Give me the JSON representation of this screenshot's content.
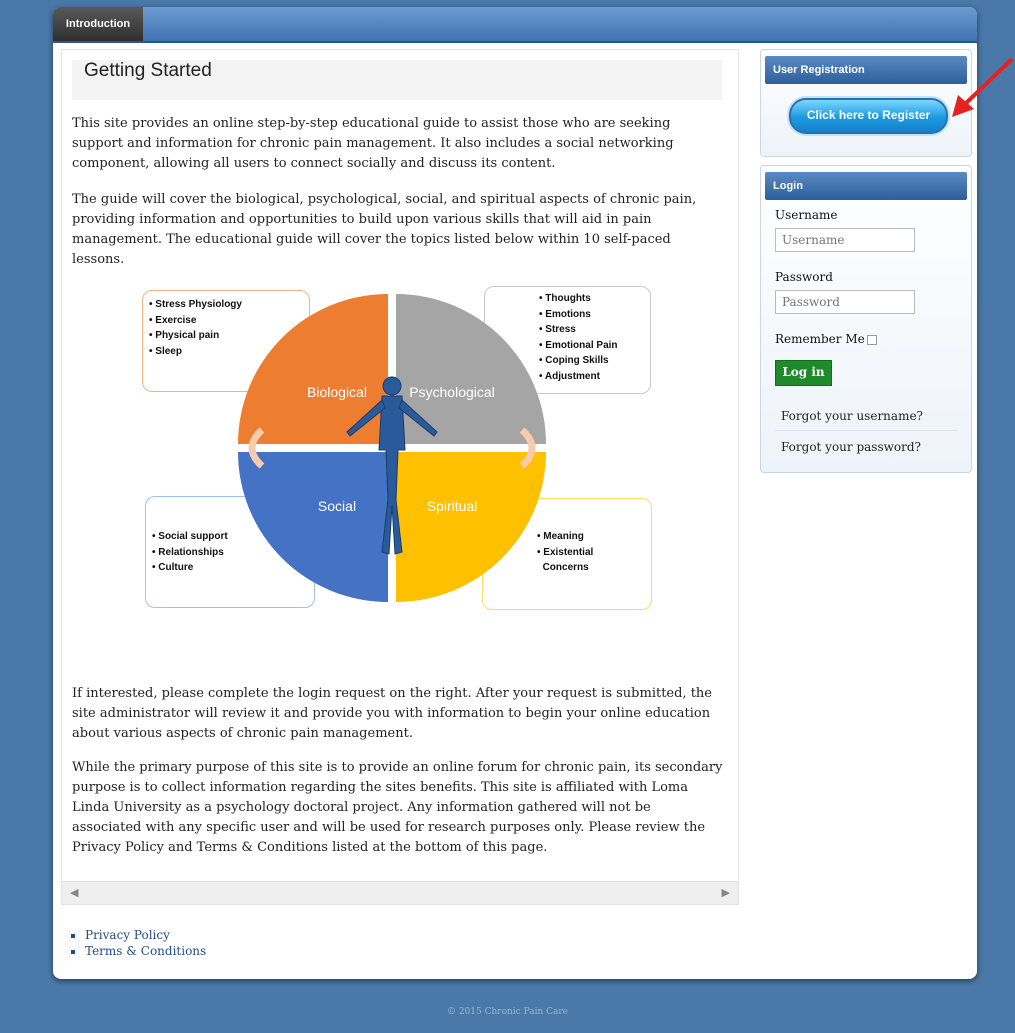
{
  "nav": {
    "tab_intro": "Introduction"
  },
  "main": {
    "title": "Getting Started",
    "para1": "This site provides an online step-by-step educational guide to assist those who are seeking support and information for chronic pain management. It also includes a social networking component, allowing all users to connect socially and discuss its content.",
    "para2": "The guide will cover the biological, psychological, social, and spiritual aspects of chronic pain, providing information and opportunities to build upon various skills that will aid in pain management. The educational guide will cover the topics listed below within 10 self-paced lessons.",
    "para3": "If interested, please complete the login request on the right. After your request is submitted, the site administrator will review it and provide you with information to begin your online education about various aspects of chronic pain management.",
    "para4": "While the primary purpose of this site is to provide an online forum for chronic pain, its secondary purpose is to collect information regarding the sites benefits. This site is affiliated with Loma Linda University as a psychology doctoral project. Any information gathered will not be associated with any specific user and will be used for research purposes only. Please review the Privacy Policy and Terms & Conditions listed at the bottom of this page."
  },
  "diagram": {
    "biological": {
      "label": "Biological",
      "color": "#ed7d31",
      "items": [
        "Stress Physiology",
        "Exercise",
        "Physical pain",
        "Sleep"
      ]
    },
    "psychological": {
      "label": "Psychological",
      "color": "#a5a5a5",
      "items": [
        "Thoughts",
        "Emotions",
        "Stress",
        "Emotional Pain",
        "Coping Skills",
        "Adjustment"
      ]
    },
    "social": {
      "label": "Social",
      "color": "#4472c4",
      "items": [
        "Social support",
        "Relationships",
        "Culture"
      ]
    },
    "spiritual": {
      "label": "Spiritual",
      "color": "#ffc000",
      "items": [
        "Meaning",
        "Existential",
        "Concerns"
      ]
    }
  },
  "registration": {
    "heading": "User Registration",
    "button": "Click here to Register"
  },
  "login": {
    "heading": "Login",
    "username_label": "Username",
    "username_placeholder": "Username",
    "password_label": "Password",
    "password_placeholder": "Password",
    "remember_label": "Remember Me",
    "login_button": "Log in",
    "forgot_username": "Forgot your username?",
    "forgot_password": "Forgot your password?"
  },
  "footer": {
    "privacy": "Privacy Policy",
    "terms": "Terms & Conditions",
    "copyright": "© 2015 Chronic Pain Care"
  },
  "colors": {
    "background": "#4a78a8",
    "accent": "#2d5f9a",
    "login_green": "#1e8a2c",
    "annotation_arrow": "#e52222"
  }
}
